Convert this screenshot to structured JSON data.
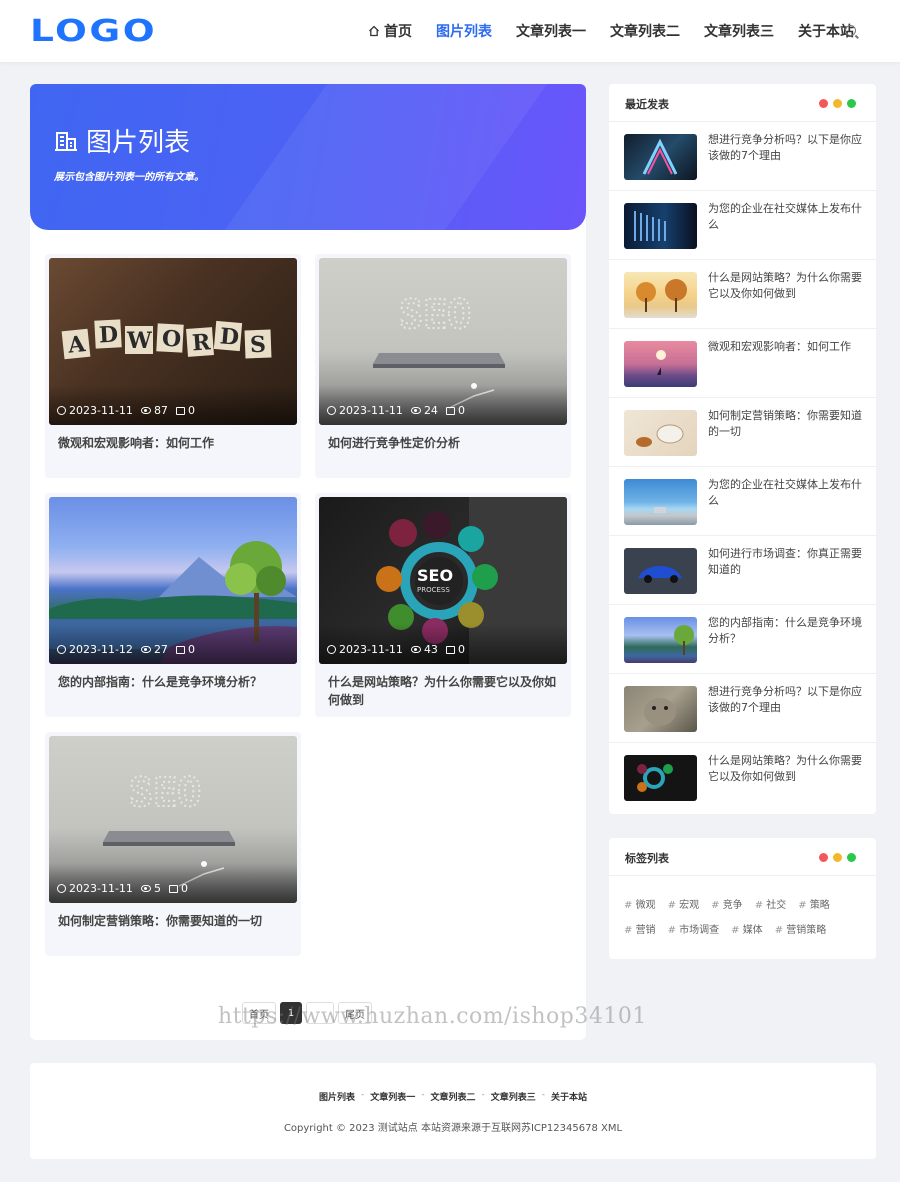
{
  "header": {
    "logo": "LOGO",
    "nav": [
      {
        "label": "首页"
      },
      {
        "label": "图片列表"
      },
      {
        "label": "文章列表一"
      },
      {
        "label": "文章列表二"
      },
      {
        "label": "文章列表三"
      },
      {
        "label": "关于本站"
      }
    ]
  },
  "banner": {
    "title": "图片列表",
    "desc": "展示包含图片列表一的所有文章。"
  },
  "cards": [
    {
      "date": "2023-11-11",
      "views": "87",
      "comments": "0",
      "title": "微观和宏观影响者：如何工作"
    },
    {
      "date": "2023-11-11",
      "views": "24",
      "comments": "0",
      "title": "如何进行竞争性定价分析"
    },
    {
      "date": "2023-11-12",
      "views": "27",
      "comments": "0",
      "title": "您的内部指南：什么是竞争环境分析？"
    },
    {
      "date": "2023-11-11",
      "views": "43",
      "comments": "0",
      "title": "什么是网站策略？为什么你需要它以及你如何做到"
    },
    {
      "date": "2023-11-11",
      "views": "5",
      "comments": "0",
      "title": "如何制定营销策略：你需要知道的一切"
    }
  ],
  "pager": {
    "first": "首页",
    "current": "1",
    "next": "",
    "last": "尾页"
  },
  "recent": {
    "title": "最近发表",
    "posts": [
      {
        "title": "想进行竞争分析吗？以下是你应该做的7个理由"
      },
      {
        "title": "为您的企业在社交媒体上发布什么"
      },
      {
        "title": "什么是网站策略？为什么你需要它以及你如何做到"
      },
      {
        "title": "微观和宏观影响者：如何工作"
      },
      {
        "title": "如何制定营销策略：你需要知道的一切"
      },
      {
        "title": "为您的企业在社交媒体上发布什么"
      },
      {
        "title": "如何进行市场调查：你真正需要知道的"
      },
      {
        "title": "您的内部指南：什么是竞争环境分析？"
      },
      {
        "title": "想进行竞争分析吗？以下是你应该做的7个理由"
      },
      {
        "title": "什么是网站策略？为什么你需要它以及你如何做到"
      }
    ]
  },
  "tagwidget": {
    "title": "标签列表",
    "tags": [
      "微观",
      "宏观",
      "竞争",
      "社交",
      "策略",
      "营销",
      "市场调查",
      "媒体",
      "营销策略"
    ]
  },
  "footer": {
    "links": [
      "图片列表",
      "文章列表一",
      "文章列表二",
      "文章列表三",
      "关于本站"
    ],
    "copyright": "Copyright © 2023 测试站点 本站资源来源于互联网苏ICP12345678 XML"
  },
  "watermark": "https://www.huzhan.com/ishop34101",
  "colors": {
    "accent": "#2e6bf4",
    "dot_red": "#f2585b",
    "dot_yellow": "#f5b72a",
    "dot_green": "#2bc84a"
  }
}
